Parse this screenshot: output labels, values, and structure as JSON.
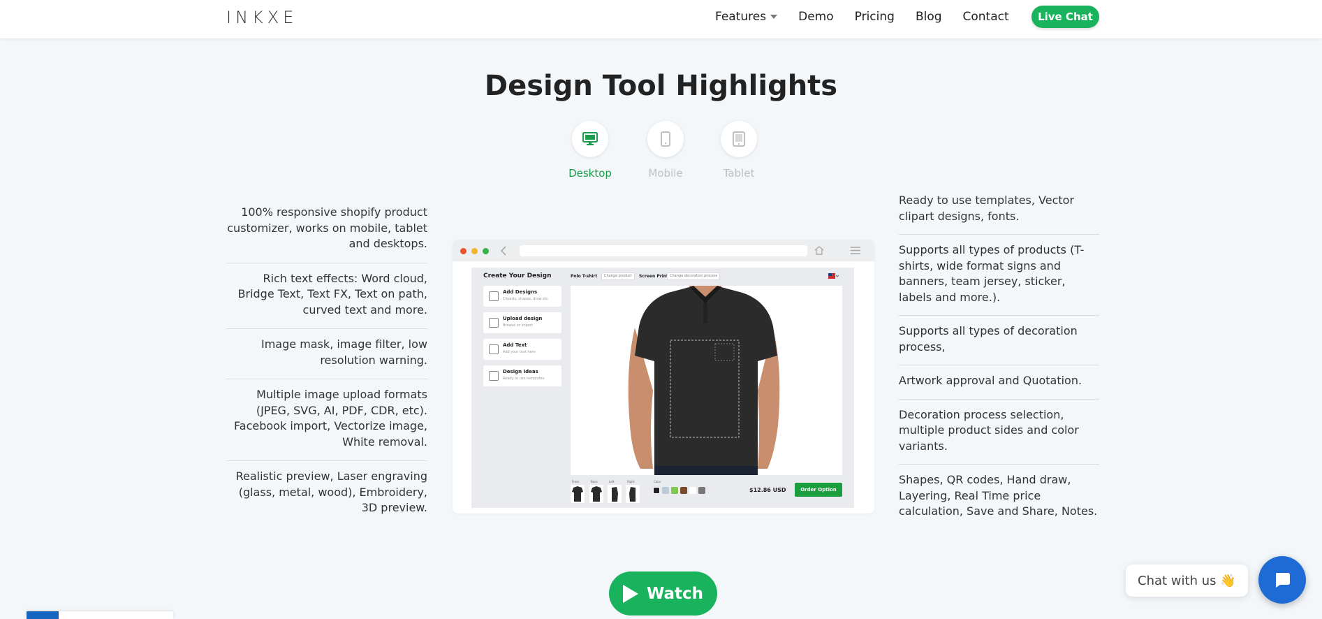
{
  "header": {
    "logo": "INKXE",
    "nav": [
      {
        "label": "Features"
      },
      {
        "label": "Demo"
      },
      {
        "label": "Pricing"
      },
      {
        "label": "Blog"
      },
      {
        "label": "Contact"
      }
    ],
    "cta": "Live Chat",
    "accent": "#1ab35d"
  },
  "section": {
    "title": "Design Tool Highlights",
    "devices": [
      {
        "label": "Desktop",
        "icon": "desktop-icon",
        "active": true
      },
      {
        "label": "Mobile",
        "icon": "mobile-icon",
        "active": false
      },
      {
        "label": "Tablet",
        "icon": "tablet-icon",
        "active": false
      }
    ],
    "left_features": [
      "100% responsive shopify product customizer, works on mobile, tablet and desktops.",
      "Rich text effects: Word cloud, Bridge Text, Text FX, Text on path, curved text and more.",
      "Image mask, image filter, low resolution warning.",
      "Multiple image upload formats (JPEG, SVG, AI, PDF, CDR, etc). Facebook import, Vectorize image, White removal.",
      "Realistic preview, Laser engraving (glass, metal, wood), Embroidery, 3D preview."
    ],
    "right_features": [
      "Ready to use templates, Vector clipart designs, fonts.",
      "Supports all types of products (T-shirts, wide format signs and banners, team jersey, sticker, labels and more.).",
      "Supports all types of decoration process,",
      "Artwork approval and Quotation.",
      "Decoration process selection, multiple product sides and color variants.",
      "Shapes, QR codes, Hand draw, Layering, Real Time price calculation, Save and Share, Notes."
    ]
  },
  "mockup": {
    "sidebar_title": "Create Your Design",
    "cards": [
      {
        "title": "Add Designs",
        "sub": "Cliparts, shapes, draw etc"
      },
      {
        "title": "Upload design",
        "sub": "Browse or import"
      },
      {
        "title": "Add Text",
        "sub": "Add your text here"
      },
      {
        "title": "Design Ideas",
        "sub": "Ready to use templates"
      }
    ],
    "product": "Polo T-shirt",
    "change_product": "Change product",
    "process": "Screen Print",
    "change_process": "Change decoration process",
    "sides": [
      "Front",
      "Back",
      "Left",
      "Right"
    ],
    "color_label": "Color",
    "swatches": [
      "#222222",
      "#b9c9d8",
      "#7ec850",
      "#4aa13a",
      "#7a4a2a",
      "#ffffff",
      "#777777"
    ],
    "price": "$12.86 USD",
    "order_button": "Order Option"
  },
  "watch_button": "Watch",
  "chat": {
    "bubble_text": "Chat with us 👋"
  }
}
